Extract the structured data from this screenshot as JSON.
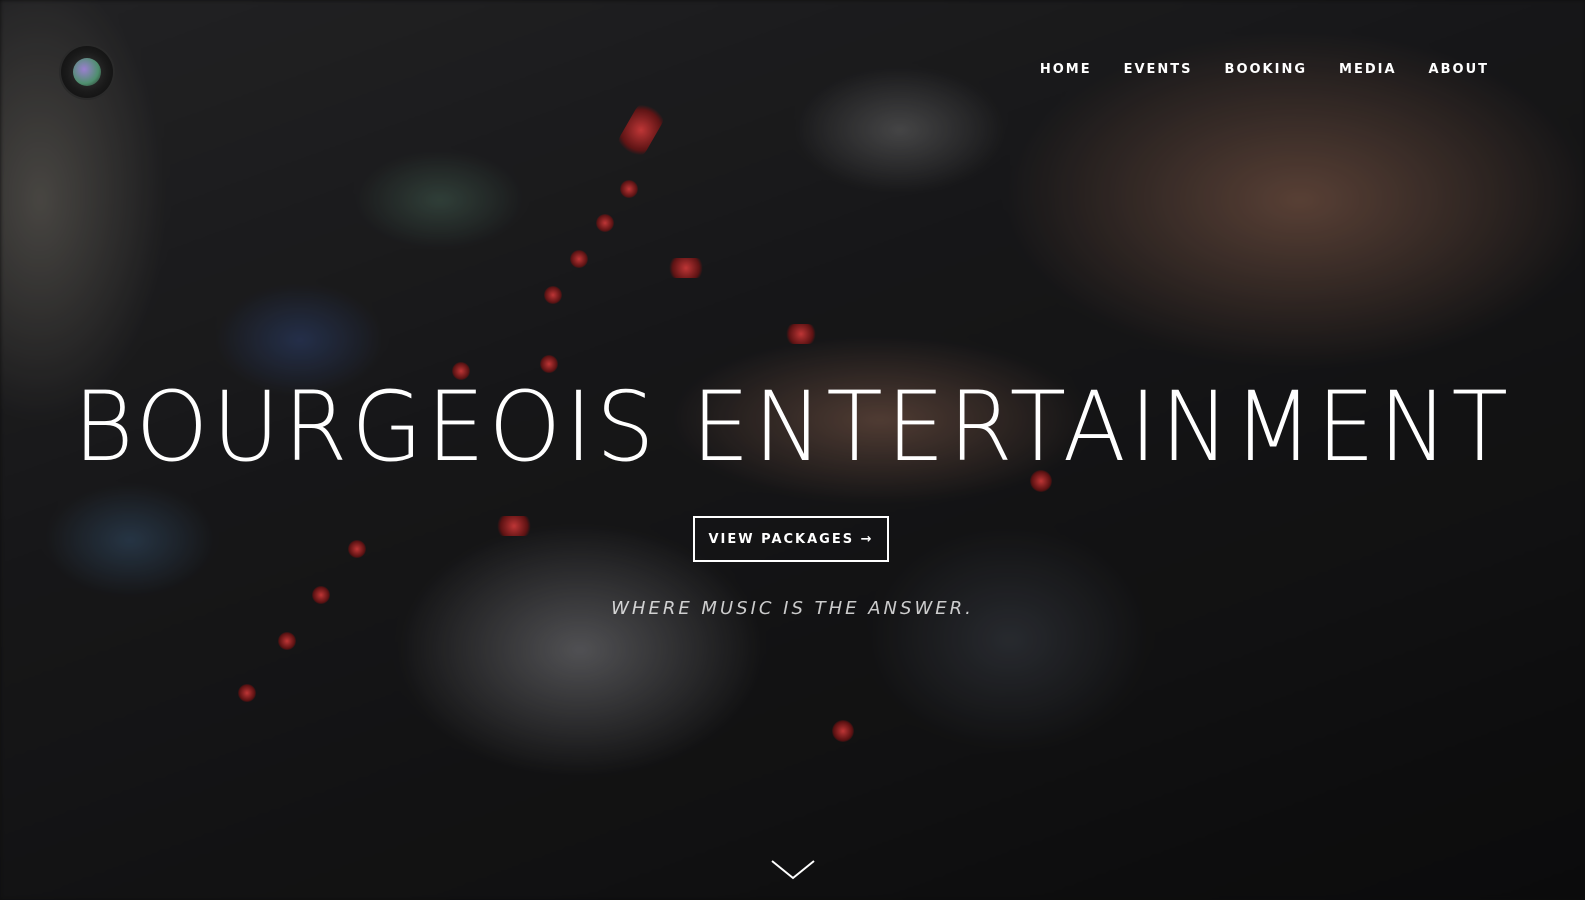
{
  "header": {
    "logo_icon": "vinyl-record-logo-icon",
    "nav": [
      {
        "label": "HOME"
      },
      {
        "label": "EVENTS"
      },
      {
        "label": "BOOKING"
      },
      {
        "label": "MEDIA"
      },
      {
        "label": "ABOUT"
      }
    ]
  },
  "hero": {
    "title": "BOURGEOIS ENTERTAINMENT",
    "cta_label": "VIEW PACKAGES →",
    "tagline": "WHERE MUSIC IS THE ANSWER.",
    "scroll_icon": "chevron-down-icon"
  },
  "colors": {
    "text": "#ffffff",
    "background": "#1a1a1c",
    "led_accent": "#e02a2a"
  }
}
